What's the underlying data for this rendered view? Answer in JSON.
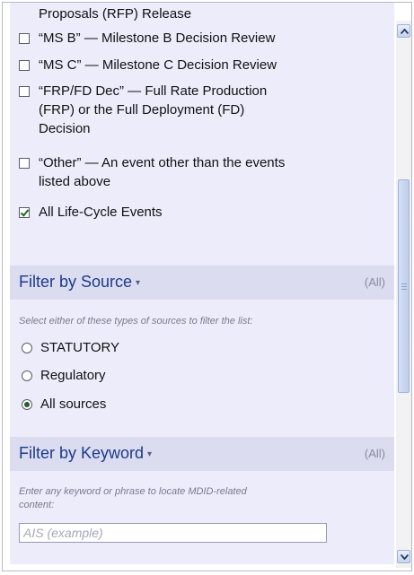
{
  "lifecycle": {
    "partial_item": "Proposals (RFP) Release",
    "items": [
      {
        "lines": [
          "“MS B” — Milestone B Decision Review"
        ],
        "checked": false
      },
      {
        "lines": [
          "“MS C” — Milestone C Decision Review"
        ],
        "checked": false
      },
      {
        "lines": [
          "“FRP/FD Dec” — Full Rate Production",
          "(FRP) or the Full Deployment (FD)",
          "Decision"
        ],
        "checked": false
      },
      {
        "lines": [
          "“Other” — An event other than the events",
          "listed above"
        ],
        "checked": false
      },
      {
        "lines": [
          "All Life-Cycle Events"
        ],
        "checked": true
      }
    ]
  },
  "source_filter": {
    "title": "Filter by Source",
    "caret": "▾",
    "all_label": "(All)",
    "hint": "Select either of these types of sources to filter the list:",
    "options": [
      {
        "label": "STATUTORY",
        "selected": false
      },
      {
        "label": "Regulatory",
        "selected": false
      },
      {
        "label": "All sources",
        "selected": true
      }
    ]
  },
  "keyword_filter": {
    "title": "Filter by Keyword",
    "caret": "▾",
    "all_label": "(All)",
    "hint_line1": "Enter any keyword or phrase to locate MDID-related",
    "hint_line2": "content:",
    "placeholder": "AIS (example)",
    "value": ""
  },
  "scrollbar": {
    "up_icon": "arrow-up-icon",
    "down_icon": "arrow-down-icon"
  }
}
